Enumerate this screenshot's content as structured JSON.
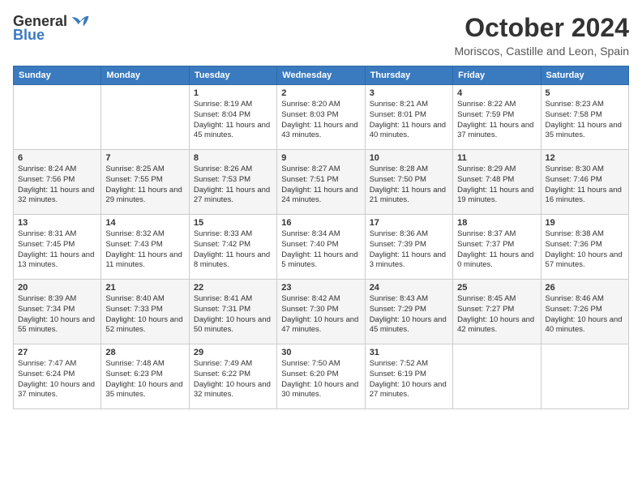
{
  "header": {
    "logo_general": "General",
    "logo_blue": "Blue",
    "month_title": "October 2024",
    "location": "Moriscos, Castille and Leon, Spain"
  },
  "days_of_week": [
    "Sunday",
    "Monday",
    "Tuesday",
    "Wednesday",
    "Thursday",
    "Friday",
    "Saturday"
  ],
  "weeks": [
    [
      {
        "day": "",
        "info": ""
      },
      {
        "day": "",
        "info": ""
      },
      {
        "day": "1",
        "info": "Sunrise: 8:19 AM\nSunset: 8:04 PM\nDaylight: 11 hours and 45 minutes."
      },
      {
        "day": "2",
        "info": "Sunrise: 8:20 AM\nSunset: 8:03 PM\nDaylight: 11 hours and 43 minutes."
      },
      {
        "day": "3",
        "info": "Sunrise: 8:21 AM\nSunset: 8:01 PM\nDaylight: 11 hours and 40 minutes."
      },
      {
        "day": "4",
        "info": "Sunrise: 8:22 AM\nSunset: 7:59 PM\nDaylight: 11 hours and 37 minutes."
      },
      {
        "day": "5",
        "info": "Sunrise: 8:23 AM\nSunset: 7:58 PM\nDaylight: 11 hours and 35 minutes."
      }
    ],
    [
      {
        "day": "6",
        "info": "Sunrise: 8:24 AM\nSunset: 7:56 PM\nDaylight: 11 hours and 32 minutes."
      },
      {
        "day": "7",
        "info": "Sunrise: 8:25 AM\nSunset: 7:55 PM\nDaylight: 11 hours and 29 minutes."
      },
      {
        "day": "8",
        "info": "Sunrise: 8:26 AM\nSunset: 7:53 PM\nDaylight: 11 hours and 27 minutes."
      },
      {
        "day": "9",
        "info": "Sunrise: 8:27 AM\nSunset: 7:51 PM\nDaylight: 11 hours and 24 minutes."
      },
      {
        "day": "10",
        "info": "Sunrise: 8:28 AM\nSunset: 7:50 PM\nDaylight: 11 hours and 21 minutes."
      },
      {
        "day": "11",
        "info": "Sunrise: 8:29 AM\nSunset: 7:48 PM\nDaylight: 11 hours and 19 minutes."
      },
      {
        "day": "12",
        "info": "Sunrise: 8:30 AM\nSunset: 7:46 PM\nDaylight: 11 hours and 16 minutes."
      }
    ],
    [
      {
        "day": "13",
        "info": "Sunrise: 8:31 AM\nSunset: 7:45 PM\nDaylight: 11 hours and 13 minutes."
      },
      {
        "day": "14",
        "info": "Sunrise: 8:32 AM\nSunset: 7:43 PM\nDaylight: 11 hours and 11 minutes."
      },
      {
        "day": "15",
        "info": "Sunrise: 8:33 AM\nSunset: 7:42 PM\nDaylight: 11 hours and 8 minutes."
      },
      {
        "day": "16",
        "info": "Sunrise: 8:34 AM\nSunset: 7:40 PM\nDaylight: 11 hours and 5 minutes."
      },
      {
        "day": "17",
        "info": "Sunrise: 8:36 AM\nSunset: 7:39 PM\nDaylight: 11 hours and 3 minutes."
      },
      {
        "day": "18",
        "info": "Sunrise: 8:37 AM\nSunset: 7:37 PM\nDaylight: 11 hours and 0 minutes."
      },
      {
        "day": "19",
        "info": "Sunrise: 8:38 AM\nSunset: 7:36 PM\nDaylight: 10 hours and 57 minutes."
      }
    ],
    [
      {
        "day": "20",
        "info": "Sunrise: 8:39 AM\nSunset: 7:34 PM\nDaylight: 10 hours and 55 minutes."
      },
      {
        "day": "21",
        "info": "Sunrise: 8:40 AM\nSunset: 7:33 PM\nDaylight: 10 hours and 52 minutes."
      },
      {
        "day": "22",
        "info": "Sunrise: 8:41 AM\nSunset: 7:31 PM\nDaylight: 10 hours and 50 minutes."
      },
      {
        "day": "23",
        "info": "Sunrise: 8:42 AM\nSunset: 7:30 PM\nDaylight: 10 hours and 47 minutes."
      },
      {
        "day": "24",
        "info": "Sunrise: 8:43 AM\nSunset: 7:29 PM\nDaylight: 10 hours and 45 minutes."
      },
      {
        "day": "25",
        "info": "Sunrise: 8:45 AM\nSunset: 7:27 PM\nDaylight: 10 hours and 42 minutes."
      },
      {
        "day": "26",
        "info": "Sunrise: 8:46 AM\nSunset: 7:26 PM\nDaylight: 10 hours and 40 minutes."
      }
    ],
    [
      {
        "day": "27",
        "info": "Sunrise: 7:47 AM\nSunset: 6:24 PM\nDaylight: 10 hours and 37 minutes."
      },
      {
        "day": "28",
        "info": "Sunrise: 7:48 AM\nSunset: 6:23 PM\nDaylight: 10 hours and 35 minutes."
      },
      {
        "day": "29",
        "info": "Sunrise: 7:49 AM\nSunset: 6:22 PM\nDaylight: 10 hours and 32 minutes."
      },
      {
        "day": "30",
        "info": "Sunrise: 7:50 AM\nSunset: 6:20 PM\nDaylight: 10 hours and 30 minutes."
      },
      {
        "day": "31",
        "info": "Sunrise: 7:52 AM\nSunset: 6:19 PM\nDaylight: 10 hours and 27 minutes."
      },
      {
        "day": "",
        "info": ""
      },
      {
        "day": "",
        "info": ""
      }
    ]
  ]
}
